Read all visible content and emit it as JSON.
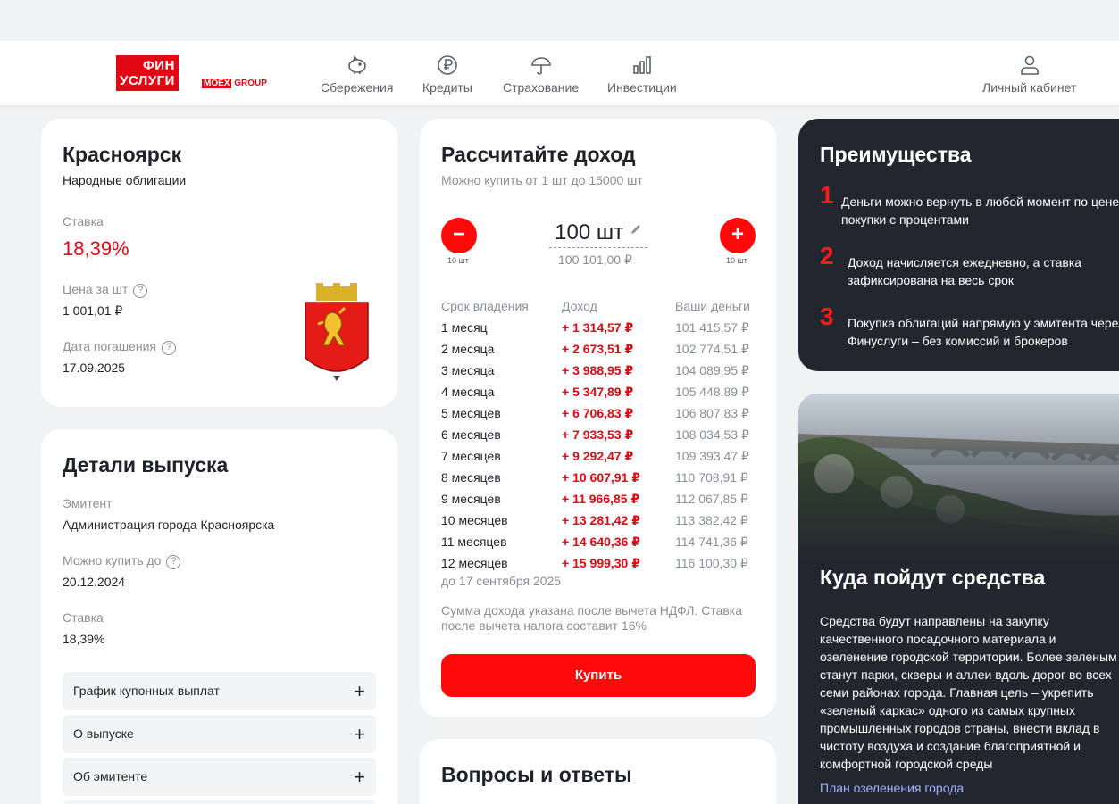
{
  "header": {
    "logo_line1": "ФИН",
    "logo_line2": "УСЛУГИ",
    "logo_moex": "MOEX",
    "logo_group": "GROUP",
    "nav": [
      {
        "label": "Сбережения",
        "icon": "piggy-bank-icon"
      },
      {
        "label": "Кредиты",
        "icon": "ruble-coin-icon"
      },
      {
        "label": "Страхование",
        "icon": "umbrella-icon"
      },
      {
        "label": "Инвестиции",
        "icon": "bar-chart-icon"
      }
    ],
    "account_label": "Личный кабинет",
    "account_icon": "user-icon"
  },
  "bond": {
    "city": "Красноярск",
    "type": "Народные облигации",
    "rate_label": "Ставка",
    "rate": "18,39%",
    "price_label": "Цена за шт",
    "price": "1 001,01 ₽",
    "maturity_label": "Дата погашения",
    "maturity": "17.09.2025",
    "emblem_icon": "krasnoyarsk-coat-of-arms-icon"
  },
  "details": {
    "title": "Детали выпуска",
    "issuer_label": "Эмитент",
    "issuer": "Администрация города Красноярска",
    "buy_until_label": "Можно купить до",
    "buy_until": "20.12.2024",
    "rate_label": "Ставка",
    "rate": "18,39%",
    "accordion": [
      "График купонных выплат",
      "О выпуске",
      "Об эмитенте"
    ]
  },
  "calculator": {
    "title": "Рассчитайте доход",
    "subtitle": "Можно купить от 1 шт до 15000 шт",
    "quantity": "100",
    "unit": "шт",
    "amount": "100 101,00 ₽",
    "step_minus": "10 шт",
    "step_plus": "10 шт",
    "columns": [
      "Срок владения",
      "Доход",
      "Ваши деньги"
    ],
    "rows": [
      [
        "1 месяц",
        "+ 1 314,57 ₽",
        "101 415,57 ₽"
      ],
      [
        "2 месяца",
        "+ 2 673,51 ₽",
        "102 774,51 ₽"
      ],
      [
        "3 месяца",
        "+ 3 988,95 ₽",
        "104 089,95 ₽"
      ],
      [
        "4 месяца",
        "+ 5 347,89 ₽",
        "105 448,89 ₽"
      ],
      [
        "5 месяцев",
        "+ 6 706,83 ₽",
        "106 807,83 ₽"
      ],
      [
        "6 месяцев",
        "+ 7 933,53 ₽",
        "108 034,53 ₽"
      ],
      [
        "7 месяцев",
        "+ 9 292,47 ₽",
        "109 393,47 ₽"
      ],
      [
        "8 месяцев",
        "+ 10 607,91 ₽",
        "110 708,91 ₽"
      ],
      [
        "9 месяцев",
        "+ 11 966,85 ₽",
        "112 067,85 ₽"
      ],
      [
        "10 месяцев",
        "+ 13 281,42 ₽",
        "113 382,42 ₽"
      ],
      [
        "11 месяцев",
        "+ 14 640,36 ₽",
        "114 741,36 ₽"
      ],
      [
        "12 месяцев",
        "+ 15 999,30 ₽",
        "116 100,30 ₽"
      ]
    ],
    "until": "до 17 сентября 2025",
    "note": "Сумма дохода указана после вычета НДФЛ. Ставка после вычета налога составит 16%",
    "buy_label": "Купить"
  },
  "faq": {
    "title": "Вопросы и ответы"
  },
  "advantages": {
    "title": "Преимущества",
    "items": [
      {
        "num": "1",
        "text1": "Деньги можно вернуть в любой момент по цене",
        "text2": "покупки с процентами"
      },
      {
        "num": "2",
        "text1": "Доход начисляется ежедневно, а ставка",
        "text2": "зафиксирована на весь срок"
      },
      {
        "num": "3",
        "text1": "Покупка облигаций напрямую у эмитента через",
        "text2": "Финуслуги – без комиссий и брокеров"
      }
    ]
  },
  "funds": {
    "title": "Куда пойдут средства",
    "text": "Средства будут направлены на закупку качественного посадочного материала и озеленение городской территории. Более зеленым станут парки, скверы и аллеи вдоль дорог во всех семи районах города. Главная цель – укрепить «зеленый каркас» одного из самых крупных промышленных городов страны, внести вклад в чистоту воздуха и создание благоприятной и комфортной городской среды",
    "link": "План озеленения города"
  }
}
